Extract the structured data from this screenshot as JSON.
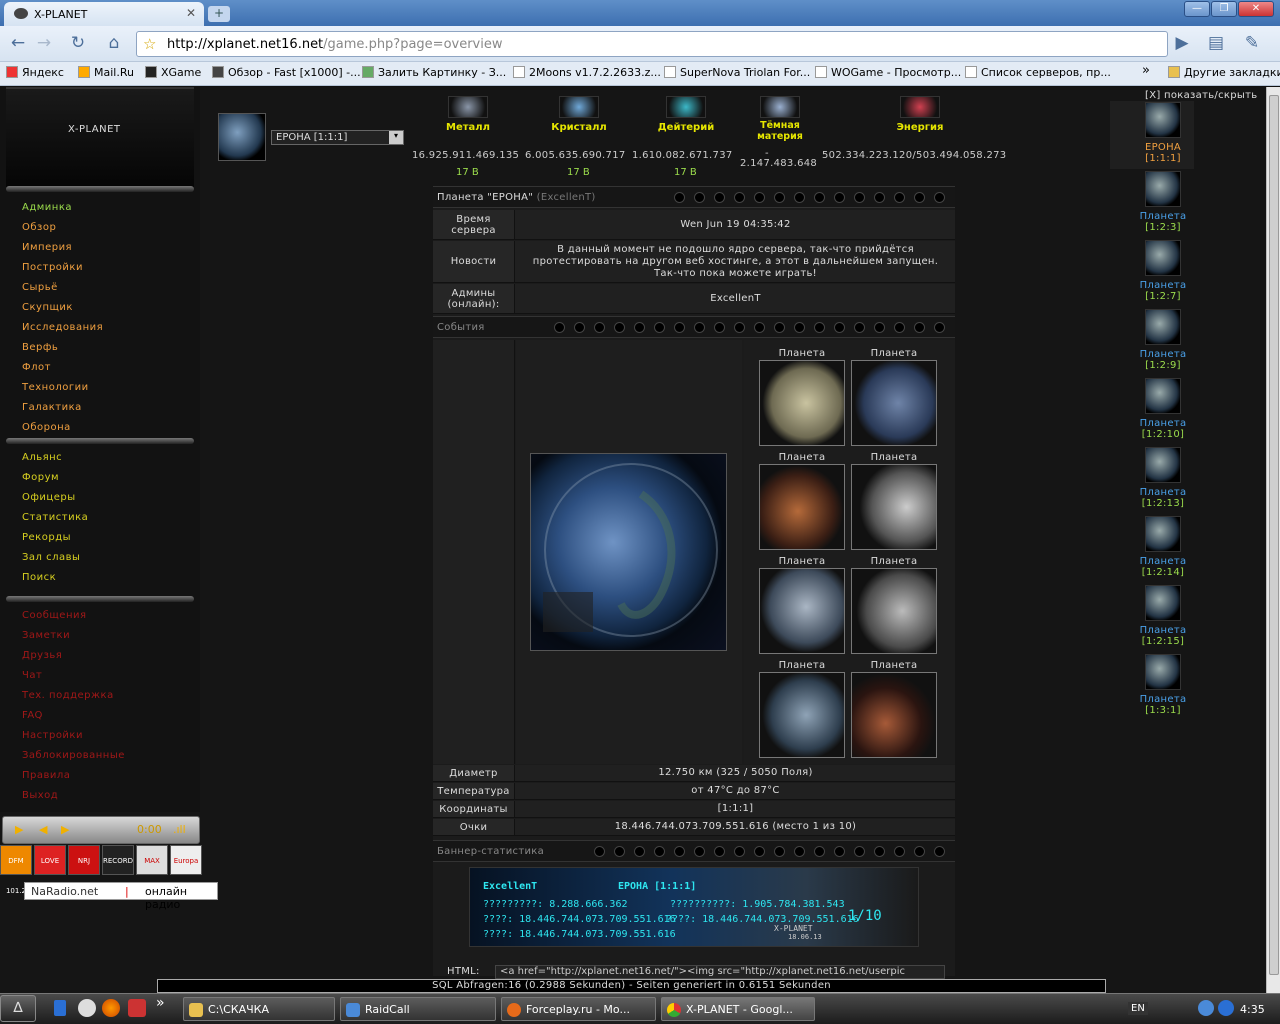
{
  "browser": {
    "tab_title": "X-PLANET",
    "tab_close": "✕",
    "new_tab": "+",
    "win_min": "—",
    "win_max": "❐",
    "win_close": "✕",
    "url_host": "http://xplanet.net16.net",
    "url_path": "/game.php?page=overview",
    "bookmarks": [
      "Яндекс",
      "Mail.Ru",
      "XGame",
      "Обзор - Fast [x1000] -...",
      "Залить Картинку - З...",
      "2Moons v1.7.2.2633.z...",
      "SuperNova Triolan For...",
      "WOGame - Просмотр...",
      "Список серверов, пр..."
    ],
    "other_bookmarks": "Другие закладки",
    "more": "»"
  },
  "sidebar": {
    "logo": "X-PLANET",
    "menu1": [
      {
        "label": "Админка",
        "c": "g"
      },
      {
        "label": "Обзор",
        "c": "o"
      },
      {
        "label": "Империя",
        "c": "o"
      },
      {
        "label": "Постройки",
        "c": "o"
      },
      {
        "label": "Сырьё",
        "c": "o"
      },
      {
        "label": "Скупщик",
        "c": "o"
      },
      {
        "label": "Исследования",
        "c": "o"
      },
      {
        "label": "Верфь",
        "c": "o"
      },
      {
        "label": "Флот",
        "c": "o"
      },
      {
        "label": "Технологии",
        "c": "o"
      },
      {
        "label": "Галактика",
        "c": "o"
      },
      {
        "label": "Оборона",
        "c": "o"
      }
    ],
    "menu2": [
      "Альянс",
      "Форум",
      "Офицеры",
      "Статистика",
      "Рекорды",
      "Зал славы",
      "Поиск"
    ],
    "menu3": [
      "Сообщения",
      "Заметки",
      "Друзья",
      "Чат",
      "Тех. поддержка",
      "FAQ",
      "Настройки",
      "Заблокированные",
      "Правила",
      "Выход"
    ]
  },
  "player": {
    "play": "▶",
    "prev": "◀",
    "next": "▶",
    "time": "0:00",
    "bars": ".ıll"
  },
  "radios": [
    "DFM 101.2",
    "LOVE",
    "NRJ",
    "RECORD",
    "MAX",
    "Europa plus"
  ],
  "naradio": {
    "name": "NaRadio.net",
    "slogan": "онлайн радио",
    "sep": "|"
  },
  "planet_select": {
    "value": "ЕРОНА [1:1:1]",
    "arrow": "▾"
  },
  "resources": [
    {
      "name": "Металл",
      "amount": "16.925.911.469.135",
      "prod": "17 B",
      "color": "#8a96a8"
    },
    {
      "name": "Кристалл",
      "amount": "6.005.635.690.717",
      "prod": "17 B",
      "color": "#6fa8d8"
    },
    {
      "name": "Дейтерий",
      "amount": "1.610.082.671.737",
      "prod": "17 B",
      "color": "#3cb8c8"
    },
    {
      "name": "Тёмная материя",
      "amount": "-\n2.147.483.648",
      "prod": "",
      "color": "#9ab0d0"
    },
    {
      "name": "Энергия",
      "amount": "502.334.223.120/503.494.058.273",
      "prod": "",
      "color": "#d04050"
    }
  ],
  "overview": {
    "planet_header_prefix": "Планета \"ЕРОНА\"",
    "planet_header_owner": "(ExcellenT)",
    "server_time_label": "Время сервера",
    "server_time": "Wen Jun 19 04:35:42",
    "news_label": "Новости",
    "news": "В данный момент не подошло ядро сервера, так-что прийдётся протестировать на другом веб хостинге, а этот в дальнейшем запущен. Так-что пока можете играть!",
    "admins_label": "Админы (онлайн):",
    "admins": "ExcellenT",
    "events_header": "События",
    "planet_caption": "Планета",
    "diameter_label": "Диаметр",
    "diameter": "12.750 км (325 / 5050 Поля)",
    "temp_label": "Температура",
    "temp": "от 47°C до 87°C",
    "coords_label": "Координаты",
    "coords": "[1:1:1]",
    "points_label": "Очки",
    "points": "18.446.744.073.709.551.616 (место 1 из 10)",
    "banner_header": "Баннер-статистика",
    "html_label": "HTML:",
    "html_code": "<a href=\"http://xplanet.net16.net/\"><img src=\"http://xplanet.net16.net/userpic"
  },
  "banner": {
    "user": "ExcellenT",
    "planet": "ЕРОНА [1:1:1]",
    "l1a": "?????????: 8.288.666.362",
    "l1b": "??????????: 1.905.784.381.543",
    "l2a": "????: 18.446.744.073.709.551.616",
    "l2b": "????: 18.446.744.073.709.551.616",
    "l3": "????: 18.446.744.073.709.551.616",
    "rank": "1/10",
    "brand": "X-PLANET",
    "date": "18.06.13"
  },
  "rightbar": {
    "toggle": "[X] показать/скрыть",
    "planets": [
      {
        "name": "ЕРОНА",
        "coords": "[1:1:1]",
        "active": true
      },
      {
        "name": "Планета",
        "coords": "[1:2:3]"
      },
      {
        "name": "Планета",
        "coords": "[1:2:7]"
      },
      {
        "name": "Планета",
        "coords": "[1:2:9]"
      },
      {
        "name": "Планета",
        "coords": "[1:2:10]"
      },
      {
        "name": "Планета",
        "coords": "[1:2:13]"
      },
      {
        "name": "Планета",
        "coords": "[1:2:14]"
      },
      {
        "name": "Планета",
        "coords": "[1:2:15]"
      },
      {
        "name": "Планета",
        "coords": "[1:3:1]"
      }
    ]
  },
  "sql": "SQL Abfragen:16 (0.2988 Sekunden) - Seiten generiert in 0.6151 Sekunden",
  "taskbar": {
    "tasks": [
      "C:\\СКАЧКА",
      "RaidCall",
      "Forceplay.ru - Mo...",
      "X-PLANET - Googl..."
    ],
    "lang": "EN",
    "clock": "4:35",
    "quick": "»"
  }
}
